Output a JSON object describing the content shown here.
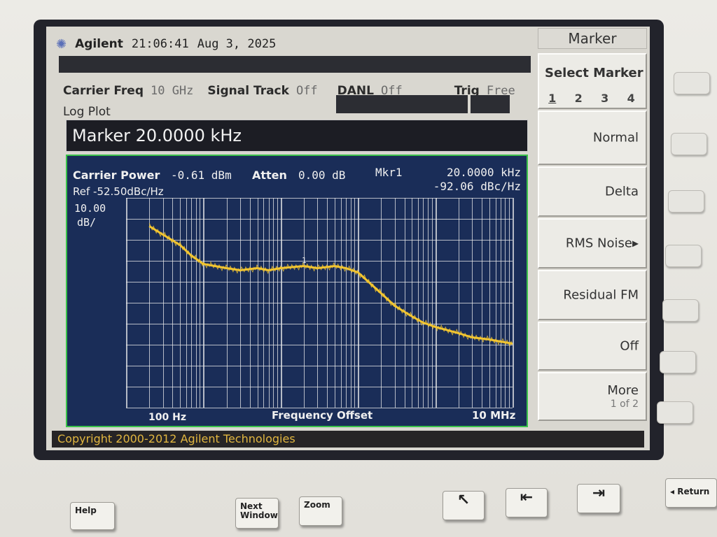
{
  "header": {
    "brand": "Agilent",
    "time": "21:06:41",
    "date": "Aug 3, 2025"
  },
  "settings": {
    "carrier_freq_label": "Carrier Freq",
    "carrier_freq_value": "10 GHz",
    "signal_track_label": "Signal Track",
    "signal_track_value": "Off",
    "danl_label": "DANL",
    "danl_value": "Off",
    "trig_label": "Trig",
    "trig_value": "Free",
    "mode_label": "Log Plot"
  },
  "marker_entry": "Marker 20.0000 kHz",
  "plot": {
    "carrier_power_label": "Carrier Power",
    "carrier_power_value": "-0.61 dBm",
    "atten_label": "Atten",
    "atten_value": "0.00 dB",
    "mkr_label": "Mkr1",
    "mkr_freq": "20.0000 kHz",
    "mkr_level": "-92.06 dBc/Hz",
    "ref": "Ref -52.50dBc/Hz",
    "scale_value": "10.00",
    "scale_unit": "dB/",
    "x_start": "100 Hz",
    "x_label": "Frequency Offset",
    "x_stop": "10 MHz",
    "marker_tag": "1",
    "trace_color": "#f2c531",
    "grid_color": "#e8e8e8",
    "background_color": "#1a2d58"
  },
  "softkeys": {
    "menu_title": "Marker",
    "select_label": "Select Marker",
    "select_options": [
      "1",
      "2",
      "3",
      "4"
    ],
    "normal": "Normal",
    "delta": "Delta",
    "rms_noise": "RMS Noise",
    "residual_fm": "Residual FM",
    "off": "Off",
    "more": "More",
    "more_page": "1 of 2"
  },
  "footer": "Copyright 2000-2012 Agilent Technologies",
  "hardware_buttons": {
    "help": "Help",
    "next_window_line1": "Next",
    "next_window_line2": "Window",
    "zoom": "Zoom",
    "return": "Return"
  },
  "chart_data": {
    "type": "line",
    "x_scale": "log",
    "xlim": [
      100,
      10000000
    ],
    "y_scale_per_div": 10,
    "ref_level": -52.5,
    "ylim": [
      -152.5,
      -52.5
    ],
    "x": [
      200,
      300,
      500,
      700,
      1000,
      2000,
      3000,
      5000,
      7000,
      10000,
      20000,
      30000,
      50000,
      70000,
      100000,
      200000,
      300000,
      500000,
      700000,
      1000000,
      2000000,
      3000000,
      5000000,
      7000000,
      10000000
    ],
    "series": [
      {
        "values": [
          -66,
          -70,
          -75,
          -80,
          -84,
          -86,
          -87,
          -86,
          -87,
          -86,
          -85,
          -86,
          -85,
          -86,
          -88,
          -98,
          -104,
          -109,
          -112,
          -114,
          -117,
          -119,
          -120,
          -121,
          -122
        ]
      }
    ],
    "grid": true
  }
}
